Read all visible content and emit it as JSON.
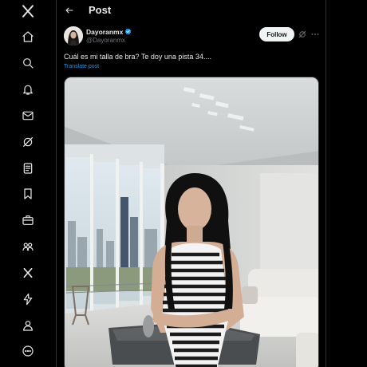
{
  "nav": {
    "items": [
      {
        "icon": "x-logo-icon"
      },
      {
        "icon": "home-icon"
      },
      {
        "icon": "search-icon"
      },
      {
        "icon": "bell-icon"
      },
      {
        "icon": "mail-icon"
      },
      {
        "icon": "grok-icon"
      },
      {
        "icon": "lists-icon"
      },
      {
        "icon": "bookmark-icon"
      },
      {
        "icon": "briefcase-icon"
      },
      {
        "icon": "communities-icon"
      },
      {
        "icon": "premium-x-icon"
      },
      {
        "icon": "verified-orgs-icon"
      },
      {
        "icon": "profile-icon"
      },
      {
        "icon": "more-circle-icon"
      }
    ]
  },
  "header": {
    "title": "Post"
  },
  "post": {
    "author_name": "Dayoranmx",
    "author_handle": "@Dayoranmx",
    "follow_label": "Follow",
    "text": "Cuál es mi talla de bra?  Te doy una pista 34....",
    "translate_label": "Translate post",
    "verified_color": "#1d9bf0"
  },
  "colors": {
    "background": "#000000",
    "text": "#e7e9ea",
    "muted": "#71767b",
    "link": "#1d9bf0",
    "border": "#2f3336"
  }
}
